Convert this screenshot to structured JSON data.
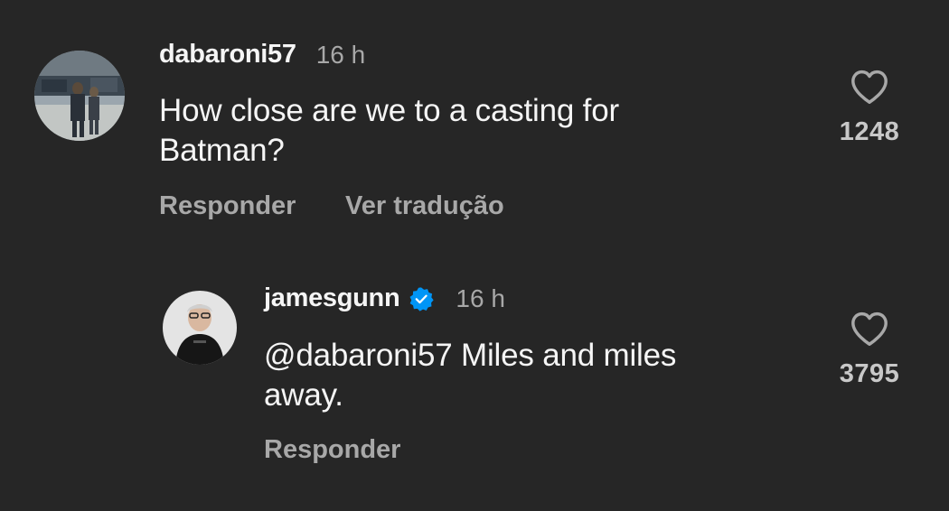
{
  "colors": {
    "background": "#262626",
    "primary_text": "#f5f5f5",
    "secondary_text": "#a8a8a8",
    "verified_badge": "#0095f6"
  },
  "comments": [
    {
      "username": "dabaroni57",
      "time": "16 h",
      "text_lines": [
        "How close are we to a casting for",
        "Batman?"
      ],
      "like_icon": "heart-outline-icon",
      "like_count": "1248",
      "reply_label": "Responder",
      "translate_label": "Ver tradução"
    },
    {
      "username": "jamesgunn",
      "verified": true,
      "verified_icon": "verified-badge-icon",
      "time": "16 h",
      "text_lines": [
        "@dabaroni57 Miles and miles",
        "away."
      ],
      "like_icon": "heart-outline-icon",
      "like_count": "3795",
      "reply_label": "Responder"
    }
  ]
}
